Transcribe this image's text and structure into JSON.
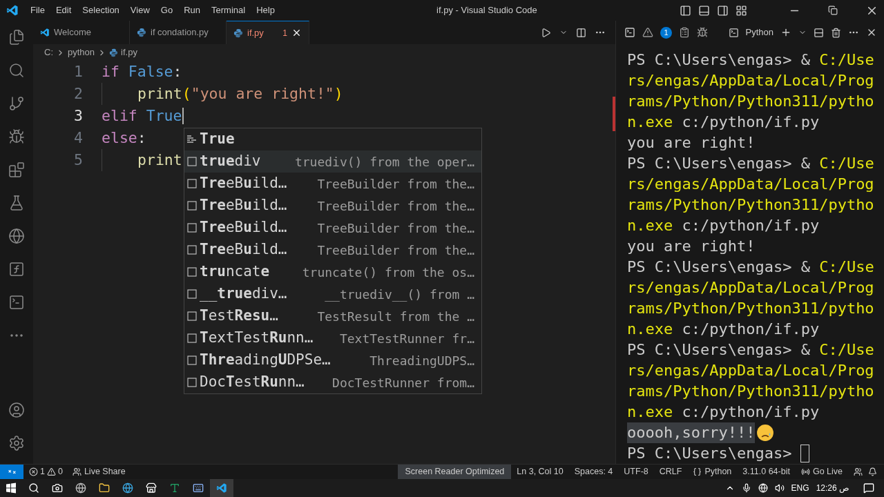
{
  "title_bar": {
    "menu": [
      "File",
      "Edit",
      "Selection",
      "View",
      "Go",
      "Run",
      "Terminal",
      "Help"
    ],
    "title": "if.py - Visual Studio Code"
  },
  "tabs": [
    {
      "label": "Welcome",
      "kind": "welcome",
      "selected": false
    },
    {
      "label": "if condation.py",
      "kind": "python",
      "selected": false
    },
    {
      "label": "if.py",
      "kind": "python",
      "selected": true,
      "problems": "1"
    }
  ],
  "breadcrumbs": [
    {
      "label": "C:",
      "kind": "folder"
    },
    {
      "label": "python",
      "kind": "folder"
    },
    {
      "label": "if.py",
      "kind": "python"
    }
  ],
  "editor": {
    "lines": [
      {
        "number": "1",
        "active": false,
        "tokens": [
          {
            "text": "if",
            "kind": "keyword"
          },
          {
            "text": " False",
            "kind": "constant"
          },
          {
            "text": ":",
            "kind": "plain"
          }
        ]
      },
      {
        "number": "2",
        "active": false,
        "indented": true,
        "tokens": [
          {
            "text": "print",
            "kind": "function"
          },
          {
            "text": "(",
            "kind": "bracket"
          },
          {
            "text": "\"you are right!\"",
            "kind": "string"
          },
          {
            "text": ")",
            "kind": "bracket"
          }
        ]
      },
      {
        "number": "3",
        "active": true,
        "cursor": true,
        "tokens": [
          {
            "text": "elif",
            "kind": "keyword"
          },
          {
            "text": " True",
            "kind": "constant"
          }
        ]
      },
      {
        "number": "4",
        "active": false,
        "tokens": [
          {
            "text": "else",
            "kind": "keyword"
          },
          {
            "text": ":",
            "kind": "plain"
          }
        ]
      },
      {
        "number": "5",
        "active": false,
        "indented": true,
        "tokens": [
          {
            "text": "print",
            "kind": "function"
          }
        ]
      }
    ]
  },
  "suggestions": [
    {
      "label": "**True**",
      "kind": "keyword",
      "selected": false
    },
    {
      "label": "**true**div",
      "detail": "truediv() from the oper…",
      "kind": "function",
      "selected": true
    },
    {
      "label": "**Tre**eB**u**ild…",
      "detail": "TreeBuilder from the…",
      "kind": "function",
      "selected": false
    },
    {
      "label": "**Tre**eB**u**ild…",
      "detail": "TreeBuilder from the…",
      "kind": "function",
      "selected": false
    },
    {
      "label": "**Tre**eB**u**ild…",
      "detail": "TreeBuilder from the…",
      "kind": "function",
      "selected": false
    },
    {
      "label": "**Tre**eB**u**ild…",
      "detail": "TreeBuilder from the…",
      "kind": "function",
      "selected": false
    },
    {
      "label": "**tru**ncat**e**",
      "detail": "truncate() from the os…",
      "kind": "function",
      "selected": false
    },
    {
      "label": "__**true**div…",
      "detail": "__truediv__() from …",
      "kind": "function",
      "selected": false
    },
    {
      "label": "**T**est**Resu**…",
      "detail": "TestResult from the …",
      "kind": "function",
      "selected": false
    },
    {
      "label": "**T**extTest**Ru**nn…",
      "detail": "TextTestRunner fr…",
      "kind": "function",
      "selected": false
    },
    {
      "label": "**Thre**ading**U**DPSe…",
      "detail": "ThreadingUDPS…",
      "kind": "function",
      "selected": false
    },
    {
      "label": "Doc**T**est**Ru**nn…",
      "detail": "DocTestRunner from…",
      "kind": "function",
      "selected": false
    }
  ],
  "terminal": {
    "problems_badge": "1",
    "shell": "Python",
    "lines": [
      {
        "kind": "command",
        "prompt": "PS C:\\Users\\engas> & ",
        "path": "C:/Users/engas/AppData/Local/Programs/Python/Python311/python.exe",
        "args": " c:/python/if.py"
      },
      {
        "kind": "output",
        "text": "you are right!"
      },
      {
        "kind": "command",
        "prompt": "PS C:\\Users\\engas> & ",
        "path": "C:/Users/engas/AppData/Local/Programs/Python/Python311/python.exe",
        "args": " c:/python/if.py"
      },
      {
        "kind": "output",
        "text": "you are right!"
      },
      {
        "kind": "command",
        "prompt": "PS C:\\Users\\engas> & ",
        "path": "C:/Users/engas/AppData/Local/Programs/Python/Python311/python.exe",
        "args": " c:/python/if.py"
      },
      {
        "kind": "command",
        "prompt": "PS C:\\Users\\engas> & ",
        "path": "C:/Users/engas/AppData/Local/Programs/Python/Python311/python.exe",
        "args": " c:/python/if.py"
      },
      {
        "kind": "output",
        "text": "ooooh,sorry!!!",
        "highlighted": true,
        "sad_emoji": true
      },
      {
        "kind": "prompt",
        "prompt": "PS C:\\Users\\engas>"
      }
    ]
  },
  "status_bar": {
    "errors": "1",
    "warnings": "0",
    "live_share": "Live Share",
    "items": [
      {
        "text": "Screen Reader Optimized",
        "kind": "badge"
      },
      {
        "text": "Ln 3, Col 10",
        "kind": "text"
      },
      {
        "text": "Spaces: 4",
        "kind": "text"
      },
      {
        "text": "UTF-8",
        "kind": "text"
      },
      {
        "text": "CRLF",
        "kind": "text"
      },
      {
        "text": "Python",
        "kind": "language"
      },
      {
        "text": "3.11.0 64-bit",
        "kind": "text"
      },
      {
        "text": "Go Live",
        "kind": "live"
      }
    ]
  },
  "taskbar": {
    "language": "ENG",
    "time": "12:26",
    "period": "ص"
  }
}
